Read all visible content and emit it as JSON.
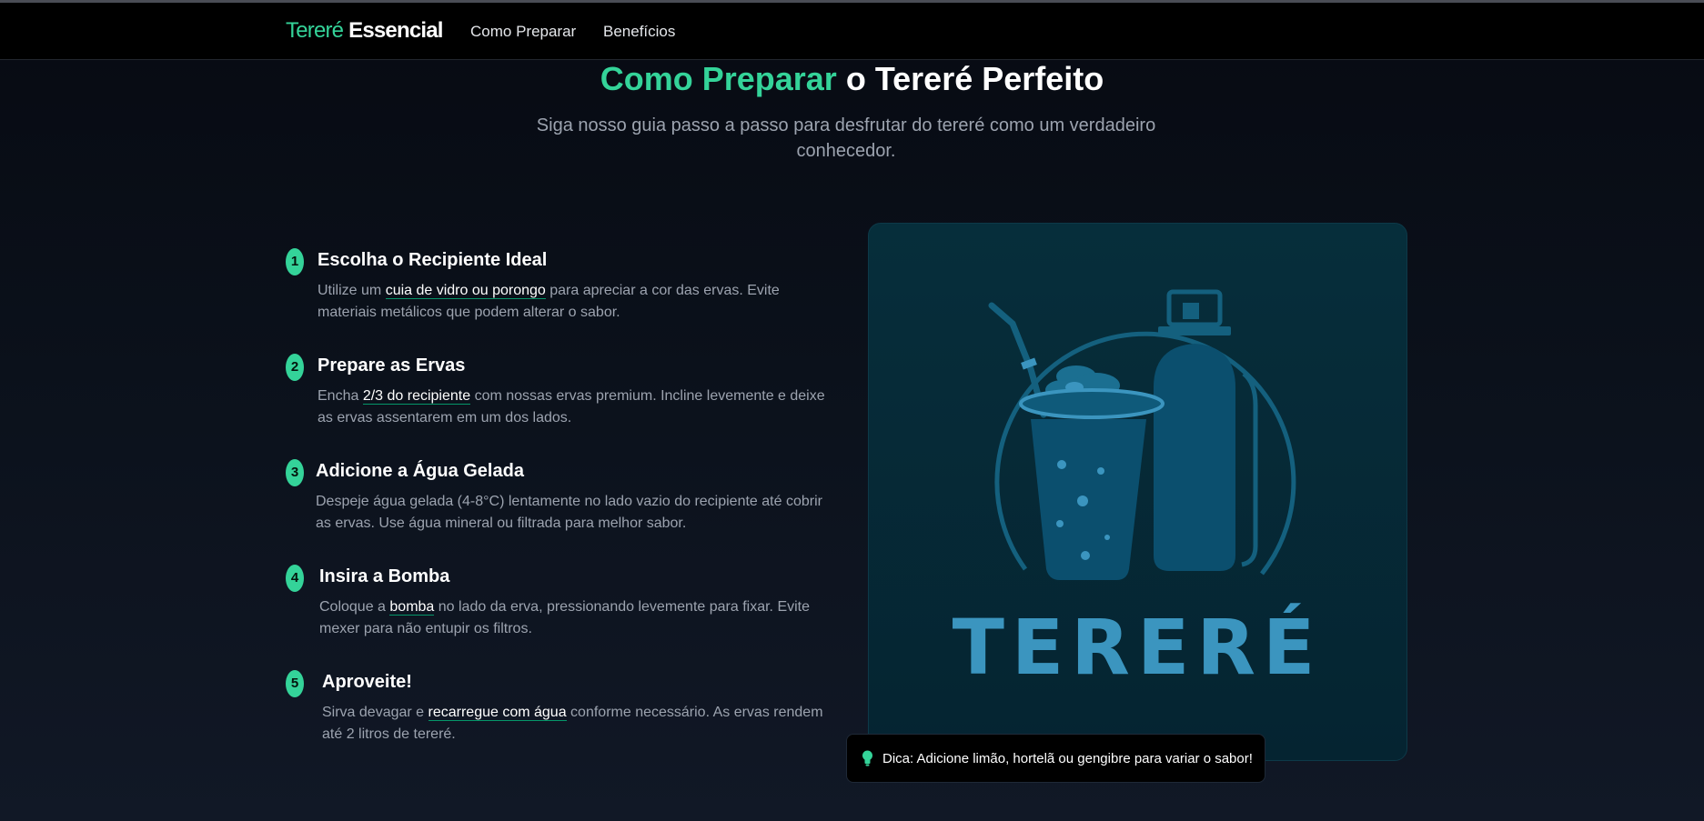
{
  "nav": {
    "brand_part1": "Tereré",
    "brand_part2": "Essencial",
    "links": [
      "Como Preparar",
      "Benefícios"
    ]
  },
  "hero": {
    "title_accent": "Como Preparar",
    "title_rest": "o Tereré Perfeito",
    "subtitle": "Siga nosso guia passo a passo para desfrutar do tereré como um verdadeiro conhecedor."
  },
  "steps": [
    {
      "number": "1",
      "title": "Escolha o Recipiente Ideal",
      "desc_before": "Utilize um ",
      "desc_highlight": "cuia de vidro ou porongo",
      "desc_after": " para apreciar a cor das ervas. Evite materiais metálicos que podem alterar o sabor."
    },
    {
      "number": "2",
      "title": "Prepare as Ervas",
      "desc_before": "Encha ",
      "desc_highlight": "2/3 do recipiente",
      "desc_after": " com nossas ervas premium. Incline levemente e deixe as ervas assentarem em um dos lados."
    },
    {
      "number": "3",
      "title": "Adicione a Água Gelada",
      "desc_before": "Despeje água gelada (4-8°C) lentamente no lado vazio do recipiente até cobrir as ervas. Use água mineral ou filtrada para melhor sabor.",
      "desc_highlight": "",
      "desc_after": ""
    },
    {
      "number": "4",
      "title": "Insira a Bomba",
      "desc_before": "Coloque a ",
      "desc_highlight": "bomba",
      "desc_after": " no lado da erva, pressionando levemente para fixar. Evite mexer para não entupir os filtros."
    },
    {
      "number": "5",
      "title": "Aproveite!",
      "desc_before": "Sirva devagar e ",
      "desc_highlight": "recarregue com água",
      "desc_after": " conforme necessário. As ervas rendem até 2 litros de tereré."
    }
  ],
  "illustration": {
    "logo_text": "TERERÉ",
    "icons": [
      "cup-with-herbs",
      "straw",
      "thermos"
    ]
  },
  "tip": {
    "icon": "lightbulb-icon",
    "text": "Dica: Adicione limão, hortelã ou gengibre para variar o sabor!"
  },
  "colors": {
    "accent": "#34d399",
    "illustration_blue": "#3b95bf",
    "card_bg": "#062e3b"
  }
}
